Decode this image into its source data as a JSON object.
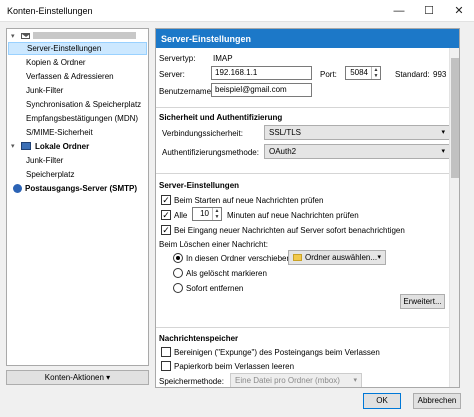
{
  "window": {
    "title": "Konten-Einstellungen",
    "minimize": "—",
    "maximize": "☐",
    "close": "✕"
  },
  "tree": {
    "items": [
      "Server-Einstellungen",
      "Kopien & Ordner",
      "Verfassen & Adressieren",
      "Junk-Filter",
      "Synchronisation & Speicherplatz",
      "Empfangsbestätigungen (MDN)",
      "S/MIME-Sicherheit"
    ],
    "local_folders": "Lokale Ordner",
    "local_items": [
      "Junk-Filter",
      "Speicherplatz"
    ],
    "smtp": "Postausgangs-Server (SMTP)",
    "account_actions": "Konten-Aktionen"
  },
  "panel": {
    "header": "Server-Einstellungen",
    "server_type_label": "Servertyp:",
    "server_type": "IMAP",
    "server_label": "Server:",
    "server_value": "192.168.1.1",
    "port_label": "Port:",
    "port_value": "5084",
    "default_label": "Standard:",
    "default_value": "993",
    "username_label": "Benutzername:",
    "username_value": "beispiel@gmail.com",
    "security": {
      "title": "Sicherheit und Authentifizierung",
      "conn_label": "Verbindungssicherheit:",
      "conn_value": "SSL/TLS",
      "auth_label": "Authentifizierungsmethode:",
      "auth_value": "OAuth2"
    },
    "server_settings": {
      "title": "Server-Einstellungen",
      "check_on_start": "Beim Starten auf neue Nachrichten prüfen",
      "every_label": "Alle",
      "every_value": "10",
      "minutes_label": "Minuten auf neue Nachrichten prüfen",
      "push_label": "Bei Eingang neuer Nachrichten auf Server sofort benachrichtigen",
      "delete_label": "Beim Löschen einer Nachricht:",
      "move_label": "In diesen Ordner verschieben:",
      "folder_choose": "Ordner auswählen...",
      "mark_deleted": "Als gelöscht markieren",
      "remove_now": "Sofort entfernen",
      "advanced": "Erweitert..."
    },
    "storage": {
      "title": "Nachrichtenspeicher",
      "expunge": "Bereinigen (\"Expunge\") des Posteingangs beim Verlassen",
      "empty_trash": "Papierkorb beim Verlassen leeren",
      "method_label": "Speichermethode:",
      "method_value": "Eine Datei pro Ordner (mbox)"
    }
  },
  "buttons": {
    "ok": "OK",
    "cancel": "Abbrechen"
  },
  "colors": {
    "header_bg": "#1c78c8",
    "selection": "#cce8ff"
  }
}
